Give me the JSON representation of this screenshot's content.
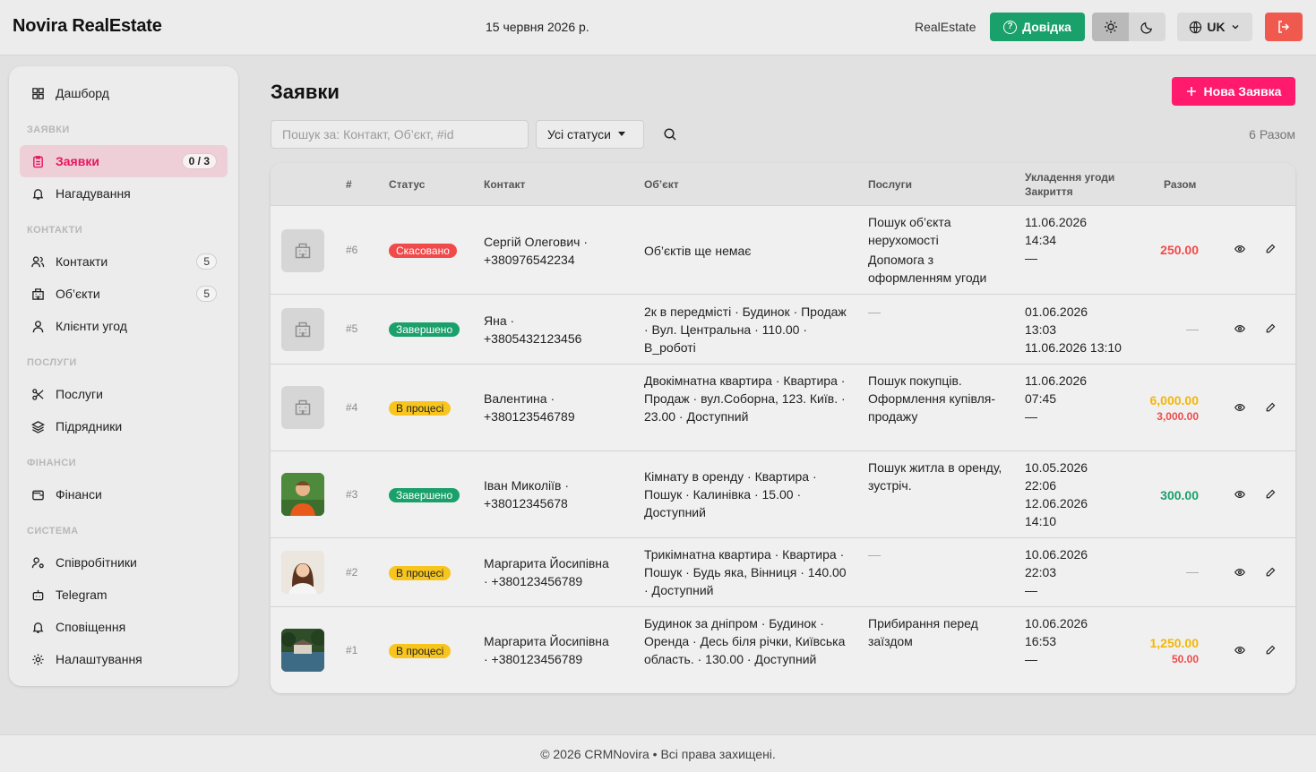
{
  "header": {
    "brand": "Novira RealEstate",
    "date": "15 червня 2026 р.",
    "user": "RealEstate",
    "help_label": "Довідка",
    "lang_label": "UK",
    "accent_help": "#1aa06a",
    "accent_logout": "#f0594e"
  },
  "sidebar": {
    "dashboard": "Дашборд",
    "sections": [
      "ЗАЯВКИ",
      "КОНТАКТИ",
      "ПОСЛУГИ",
      "ФІНАНСИ",
      "СИСТЕМА"
    ],
    "requests": "Заявки",
    "requests_badge": "0 / 3",
    "reminders": "Нагадування",
    "contacts": "Контакти",
    "contacts_badge": "5",
    "objects": "Об’єкти",
    "objects_badge": "5",
    "clients": "Клієнти угод",
    "services": "Послуги",
    "contractors": "Підрядники",
    "finance": "Фінанси",
    "employees": "Співробітники",
    "telegram": "Telegram",
    "notifications": "Сповіщення",
    "settings": "Налаштування"
  },
  "main": {
    "title": "Заявки",
    "new_button": "Нова Заявка",
    "search_placeholder": "Пошук за: Контакт, Об’єкт, #id",
    "status_select": "Усі статуси",
    "total_count": "6 Разом"
  },
  "table": {
    "headers": {
      "num": "#",
      "status": "Статус",
      "contact": "Контакт",
      "object": "Об’єкт",
      "services": "Послуги",
      "deal": "Укладення угоди",
      "closing": "Закриття",
      "total": "Разом"
    },
    "rows": [
      {
        "id": "#6",
        "status": "Скасовано",
        "contact_name": "Сергій Олегович ·",
        "contact_phone": "+380976542234",
        "object": "Об’єктів ще немає",
        "services": [
          "Пошук об’єкта нерухомості",
          "Допомога з оформленням угоди"
        ],
        "deal_date": "11.06.2026",
        "deal_time": "14:34",
        "closing": "—",
        "total": "250.00",
        "total_sub": ""
      },
      {
        "id": "#5",
        "status": "Завершено",
        "contact_name": "Яна ·",
        "contact_phone": "+3805432123456",
        "object": "2к в передмісті · Будинок · Продаж · Вул. Центральна · 110.00 · В_роботі",
        "services": [
          "—"
        ],
        "deal_date": "01.06.2026",
        "deal_time": "13:03",
        "closing": "11.06.2026 13:10",
        "total": "—",
        "total_sub": ""
      },
      {
        "id": "#4",
        "status": "В процесі",
        "contact_name": "Валентина ·",
        "contact_phone": "+380123546789",
        "object": "Двокімнатна квартира · Квартира · Продаж · вул.Соборна, 123. Київ. · 23.00 · Доступний",
        "services": [
          "Пошук покупців. Оформлення купівля-продажу"
        ],
        "deal_date": "11.06.2026",
        "deal_time": "07:45",
        "closing": "—",
        "total": "6,000.00",
        "total_sub": "3,000.00"
      },
      {
        "id": "#3",
        "status": "Завершено",
        "contact_name": "Іван Миколіїв ·",
        "contact_phone": "+38012345678",
        "object": "Кімнату в оренду · Квартира · Пошук · Калинівка · 15.00 · Доступний",
        "services": [
          "Пошук житла в оренду, зустріч."
        ],
        "deal_date": "10.05.2026",
        "deal_time": "22:06",
        "closing": "12.06.2026 14:10",
        "total": "300.00",
        "total_sub": ""
      },
      {
        "id": "#2",
        "status": "В процесі",
        "contact_name": "Маргарита Йосипівна",
        "contact_phone": "· +380123456789",
        "object": "Трикімнатна квартира · Квартира · Пошук · Будь яка, Вінниця · 140.00 · Доступний",
        "services": [
          "—"
        ],
        "deal_date": "10.06.2026",
        "deal_time": "22:03",
        "closing": "—",
        "total": "—",
        "total_sub": ""
      },
      {
        "id": "#1",
        "status": "В процесі",
        "contact_name": "Маргарита Йосипівна",
        "contact_phone": "· +380123456789",
        "object": "Будинок за дніпром · Будинок · Оренда · Десь біля річки, Київська область. · 130.00 · Доступний",
        "services": [
          "Прибирання перед заїздом"
        ],
        "deal_date": "10.06.2026",
        "deal_time": "16:53",
        "closing": "—",
        "total": "1,250.00",
        "total_sub": "50.00"
      }
    ]
  },
  "footer": {
    "text": "© 2026 CRMNovira • Всі права захищені."
  }
}
